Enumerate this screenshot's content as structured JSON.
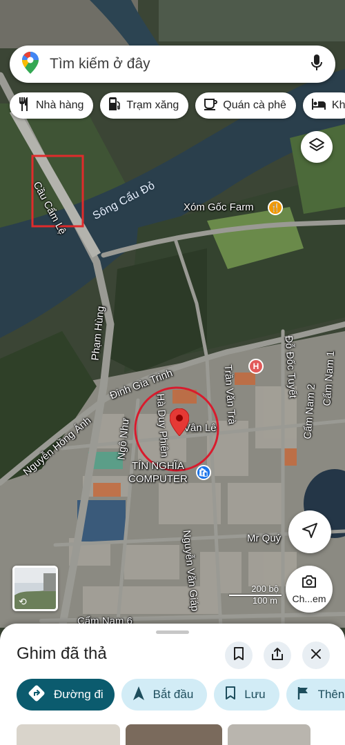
{
  "search": {
    "placeholder": "Tìm kiếm ở đây"
  },
  "chips": [
    {
      "icon": "restaurant-icon",
      "label": "Nhà hàng"
    },
    {
      "icon": "gas-station-icon",
      "label": "Trạm xăng"
    },
    {
      "icon": "coffee-icon",
      "label": "Quán cà phê"
    },
    {
      "icon": "hotel-icon",
      "label": "Kh"
    }
  ],
  "map": {
    "water_label": "Sông Cẩu Đỏ",
    "roads": {
      "bridge": "Cầu Cẩm Lệ",
      "pham_hung": "Phạm Hùng",
      "dinh_gia_trinh": "Đinh Gia Trinh",
      "nguyen_hong_anh": "Nguyễn Hồng Ánh",
      "ngo_nhu": "Ngô Như",
      "ha_duy_phien": "Hà Duy Phiên",
      "tran_van_tra": "Trần Văn Trà",
      "do_doc_tuyet": "Đỗ Đốc Tuyết",
      "cam_nam_1": "Cẩm Nam 1",
      "cam_nam_2": "Cẩm Nam 2",
      "van_le": "Vân Lê",
      "nguyen_van_giap": "Nguyễn Văn Giáp",
      "cam_nam_6": "Cẩm Nam 6"
    },
    "pois": {
      "farm": "Xóm Gốc Farm",
      "computer": "TÍN NGHĨA\nCOMPUTER",
      "mr_quy": "Mr Quý",
      "hospital_icon": "hospital-icon"
    },
    "scale": {
      "top": "200 bộ",
      "bottom": "100 m"
    },
    "camera_button_label": "Ch...em",
    "colors": {
      "river": "#2a3f4c",
      "pin": "#e53935",
      "circle": "#d81b2d",
      "highlight_box": "#e02b2b"
    }
  },
  "sheet": {
    "title": "Ghim đã thả",
    "actions": [
      {
        "icon": "directions-icon",
        "label": "Đường đi"
      },
      {
        "icon": "navigation-arrow-icon",
        "label": "Bắt đầu"
      },
      {
        "icon": "bookmark-icon",
        "label": "Lưu"
      },
      {
        "icon": "flag-icon",
        "label": "Thên"
      }
    ]
  }
}
